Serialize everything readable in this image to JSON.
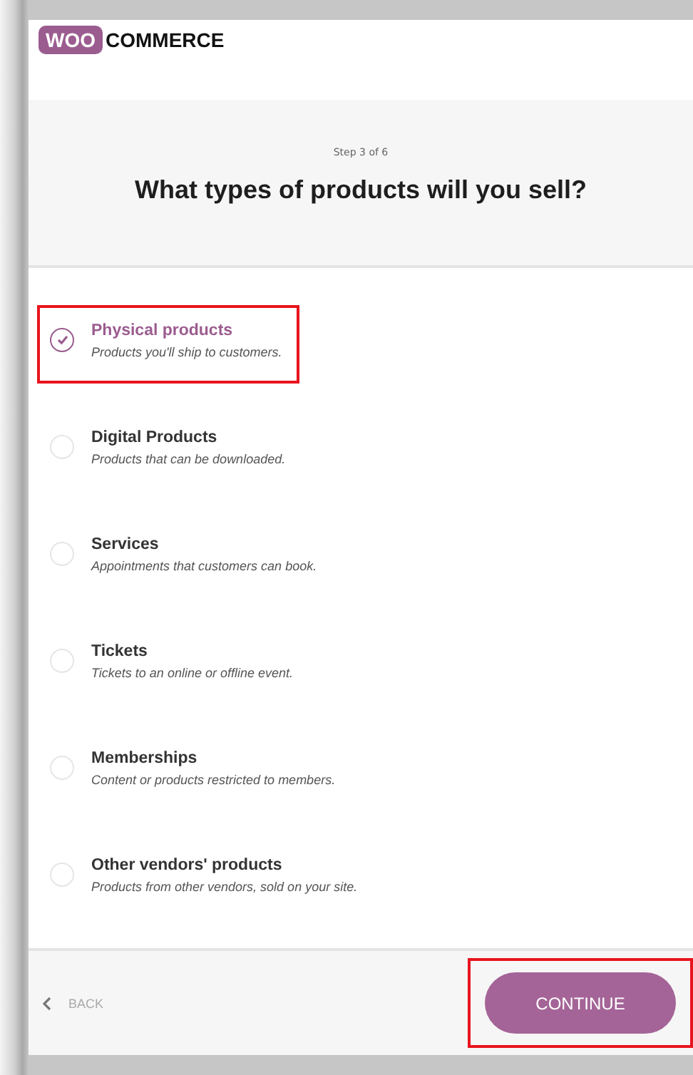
{
  "logo": {
    "badge": "WOO",
    "text": "COMMERCE"
  },
  "step": "Step 3 of 6",
  "title": "What types of products will you sell?",
  "options": [
    {
      "title": "Physical products",
      "description": "Products you'll ship to customers.",
      "selected": true,
      "highlighted": true
    },
    {
      "title": "Digital Products",
      "description": "Products that can be downloaded.",
      "selected": false,
      "highlighted": false
    },
    {
      "title": "Services",
      "description": "Appointments that customers can book.",
      "selected": false,
      "highlighted": false
    },
    {
      "title": "Tickets",
      "description": "Tickets to an online or offline event.",
      "selected": false,
      "highlighted": false
    },
    {
      "title": "Memberships",
      "description": "Content or products restricted to members.",
      "selected": false,
      "highlighted": false
    },
    {
      "title": "Other vendors' products",
      "description": "Products from other vendors, sold on your site.",
      "selected": false,
      "highlighted": false
    }
  ],
  "footer": {
    "back": "BACK",
    "continue": {
      "label": "CONTINUE",
      "highlighted": true
    }
  }
}
